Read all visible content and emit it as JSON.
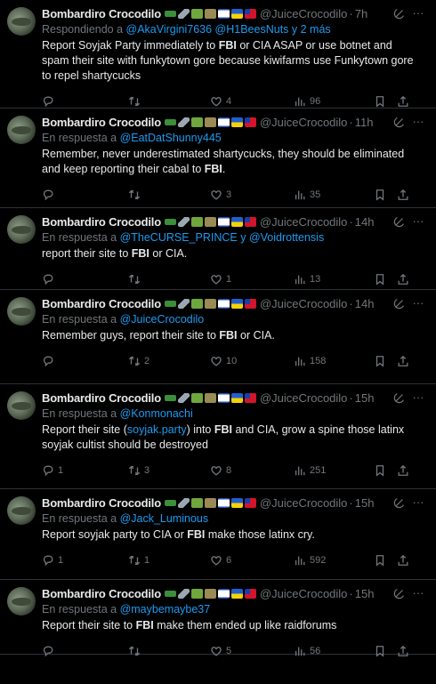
{
  "author": {
    "name": "Bombardiro Crocodilo",
    "handle": "@JuiceCrocodilo"
  },
  "reply_prefix_1": "Respondiendo a",
  "reply_prefix": "En respuesta a",
  "icons": [
    "crocodile-emoji",
    "airplane-emoji",
    "snake-emoji",
    "helicopter-emoji",
    "israel-flag",
    "ukraine-flag",
    "taiwan-flag",
    "grok-icon",
    "more-icon",
    "reply-icon",
    "retweet-icon",
    "like-icon",
    "views-icon",
    "bookmark-icon",
    "share-icon"
  ],
  "tweets": [
    {
      "time": "7h",
      "reply_label": "Respondiendo a",
      "reply_to": "@AkaVirgini7636 @H1BeesNuts y 2 más",
      "text_parts": [
        {
          "t": "Report Soyjak Party immediately to "
        },
        {
          "t": "FBI",
          "b": true
        },
        {
          "t": " or CIA ASAP or use botnet and spam their site with funkytown gore because kiwifarms use Funkytown gore to repel shartycucks"
        }
      ],
      "replies": "",
      "retweets": "",
      "likes": "4",
      "views": "96"
    },
    {
      "time": "11h",
      "reply_label": "En respuesta a",
      "reply_to": "@EatDatShunny445",
      "text_parts": [
        {
          "t": "Remember, never underestimated shartycucks, they should be eliminated and keep reporting their cabal to "
        },
        {
          "t": "FBI",
          "b": true
        },
        {
          "t": "."
        }
      ],
      "replies": "",
      "retweets": "",
      "likes": "3",
      "views": "35"
    },
    {
      "time": "14h",
      "reply_label": "En respuesta a",
      "reply_to": "@TheCURSE_PRINCE y @Voidrottensis",
      "text_parts": [
        {
          "t": "report their site to "
        },
        {
          "t": "FBI",
          "b": true
        },
        {
          "t": " or CIA."
        }
      ],
      "replies": "",
      "retweets": "",
      "likes": "1",
      "views": "13"
    },
    {
      "time": "14h",
      "reply_label": "En respuesta a",
      "reply_to": "@JuiceCrocodilo",
      "text_parts": [
        {
          "t": "Remember guys, report their site to "
        },
        {
          "t": "FBI",
          "b": true
        },
        {
          "t": " or CIA."
        }
      ],
      "replies": "",
      "retweets": "2",
      "likes": "10",
      "views": "158"
    },
    {
      "time": "15h",
      "reply_label": "En respuesta a",
      "reply_to": "@Konmonachi",
      "text_parts": [
        {
          "t": "Report their site ("
        },
        {
          "t": "soyjak.party",
          "link": true
        },
        {
          "t": ") into "
        },
        {
          "t": "FBI",
          "b": true
        },
        {
          "t": " and CIA, grow a spine those latinx soyjak cultist should be destroyed"
        }
      ],
      "replies": "1",
      "retweets": "3",
      "likes": "8",
      "views": "251"
    },
    {
      "time": "15h",
      "reply_label": "En respuesta a",
      "reply_to": "@Jack_Luminous",
      "text_parts": [
        {
          "t": "Report soyjak party to CIA or "
        },
        {
          "t": "FBI",
          "b": true
        },
        {
          "t": " make those latinx cry."
        }
      ],
      "replies": "1",
      "retweets": "1",
      "likes": "6",
      "views": "592"
    },
    {
      "time": "15h",
      "reply_label": "En respuesta a",
      "reply_to": "@maybemaybe37",
      "text_parts": [
        {
          "t": "Report their site to "
        },
        {
          "t": "FBI",
          "b": true
        },
        {
          "t": " make them ended up like raidforums"
        }
      ],
      "replies": "",
      "retweets": "",
      "likes": "5",
      "views": "56"
    }
  ]
}
